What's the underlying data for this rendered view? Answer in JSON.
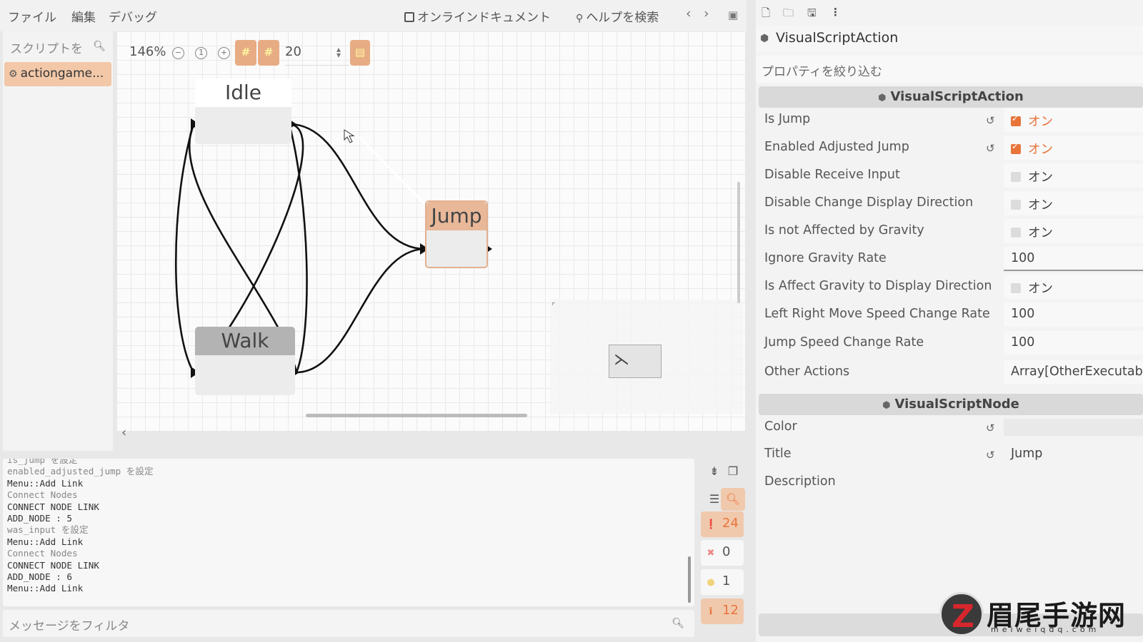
{
  "menubar": {
    "menus": [
      "ファイル",
      "編集",
      "デバッグ"
    ],
    "online_docs": "オンラインドキュメント",
    "help_search": "ヘルプを検索"
  },
  "scripts": {
    "search_placeholder": "スクリプトを",
    "items": [
      "actiongame..."
    ]
  },
  "graph_toolbar": {
    "zoom": "146%",
    "snap": "20"
  },
  "nodes": {
    "idle": "Idle",
    "walk": "Walk",
    "jump": "Jump"
  },
  "output": {
    "lines": [
      {
        "text": "is_jump を設定",
        "dim": true
      },
      {
        "text": "enabled_adjusted_jump を設定",
        "dim": true
      },
      {
        "text": "Menu::Add Link",
        "dim": false
      },
      {
        "text": "Connect Nodes",
        "dim": true
      },
      {
        "text": "CONNECT NODE LINK",
        "dim": false
      },
      {
        "text": "ADD_NODE : 5",
        "dim": false
      },
      {
        "text": "was_input を設定",
        "dim": true
      },
      {
        "text": "Menu::Add Link",
        "dim": false
      },
      {
        "text": "Connect Nodes",
        "dim": true
      },
      {
        "text": "CONNECT NODE LINK",
        "dim": false
      },
      {
        "text": "ADD_NODE : 6",
        "dim": false
      },
      {
        "text": "Menu::Add Link",
        "dim": false
      }
    ],
    "filter_placeholder": "メッセージをフィルタ",
    "counts": {
      "messages": "24",
      "errors": "0",
      "warnings": "1",
      "info": "12"
    }
  },
  "inspector": {
    "object_name": "VisualScriptAction",
    "filter_placeholder": "プロパティを絞り込む",
    "section_action": "VisualScriptAction",
    "section_node": "VisualScriptNode",
    "props": [
      {
        "label": "Is Jump",
        "type": "bool",
        "checked": true,
        "value": "オン",
        "revert": true
      },
      {
        "label": "Enabled Adjusted Jump",
        "type": "bool",
        "checked": true,
        "value": "オン",
        "revert": true
      },
      {
        "label": "Disable Receive Input",
        "type": "bool",
        "checked": false,
        "value": "オン",
        "revert": false
      },
      {
        "label": "Disable Change Display Direction",
        "type": "bool",
        "checked": false,
        "value": "オン",
        "revert": false
      },
      {
        "label": "Is not Affected by Gravity",
        "type": "bool",
        "checked": false,
        "value": "オン",
        "revert": false
      },
      {
        "label": "Ignore Gravity Rate",
        "type": "number",
        "value": "100",
        "revert": false
      },
      {
        "label": "Is Affect Gravity to Display Direction",
        "type": "bool",
        "checked": false,
        "value": "オン",
        "revert": false
      },
      {
        "label": "Left Right Move Speed Change Rate",
        "type": "number",
        "value": "100",
        "revert": false
      },
      {
        "label": "Jump Speed Change Rate",
        "type": "number",
        "value": "100",
        "revert": false
      },
      {
        "label": "Other Actions",
        "type": "array",
        "value": "Array[OtherExecutable",
        "revert": false
      }
    ],
    "node_props": [
      {
        "label": "Color",
        "value": "",
        "revert": true
      },
      {
        "label": "Title",
        "value": "Jump",
        "revert": true
      },
      {
        "label": "Description",
        "value": "",
        "revert": false
      }
    ]
  },
  "watermark": {
    "logo_glyph": "Z",
    "text": "眉尾手游网",
    "sub": "meiweiqdq.com"
  },
  "colors": {
    "accent": "#e8743a",
    "accent_soft": "#f0c9ad",
    "node_jump": "#e8b899",
    "node_walk": "#b3b3b3"
  }
}
